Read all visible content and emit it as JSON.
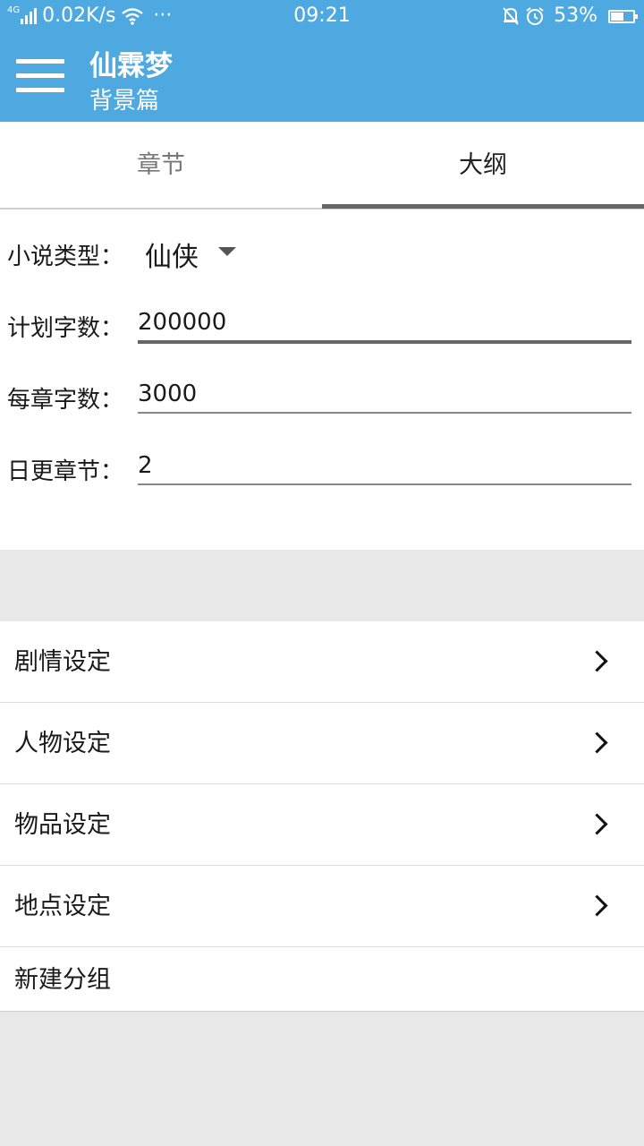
{
  "status_bar": {
    "network_type": "4G",
    "speed": "0.02K/s",
    "more": "···",
    "time": "09:21",
    "battery": "53%",
    "battery_level": 0.53
  },
  "header": {
    "title": "仙霖梦",
    "subtitle": "背景篇",
    "background_color": "#4ea9e0"
  },
  "tabs": [
    {
      "label": "章节",
      "selected": false
    },
    {
      "label": "大纲",
      "selected": true
    }
  ],
  "form": {
    "genre_label": "小说类型：",
    "genre_value": "仙侠",
    "planned_words_label": "计划字数：",
    "planned_words_value": "200000",
    "words_per_chapter_label": "每章字数：",
    "words_per_chapter_value": "3000",
    "daily_chapters_label": "日更章节：",
    "daily_chapters_value": "2"
  },
  "settings_list": [
    {
      "label": "剧情设定"
    },
    {
      "label": "人物设定"
    },
    {
      "label": "物品设定"
    },
    {
      "label": "地点设定"
    },
    {
      "label": "新建分组"
    }
  ]
}
